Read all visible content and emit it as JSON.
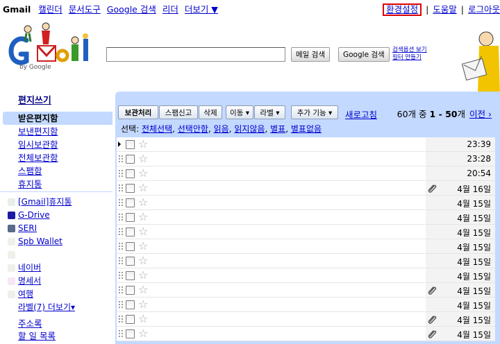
{
  "topnav": {
    "brand": "Gmail",
    "links": [
      "캘린더",
      "문서도구",
      "Google 검색",
      "리더",
      "더보기 ▼"
    ]
  },
  "topright": {
    "settings": "환경설정",
    "help": "도움말",
    "logout": "로그아웃",
    "separator": "|"
  },
  "logo": {
    "byline": "by Google"
  },
  "search": {
    "value": "",
    "mail_search": "메일 검색",
    "web_search": "Google 검색",
    "show_options": "검색옵션 보기",
    "create_filter": "필터 만들기"
  },
  "sidebar": {
    "compose": "편지쓰기",
    "items": [
      {
        "label": "받은편지함",
        "selected": true
      },
      {
        "label": "보낸편지함",
        "selected": false
      },
      {
        "label": "임시보관함",
        "selected": false
      },
      {
        "label": "전체보관함",
        "selected": false
      },
      {
        "label": "스팸함",
        "selected": false
      },
      {
        "label": "휴지통",
        "selected": false
      }
    ],
    "labels": [
      {
        "name": "[Gmail]휴지통",
        "color": "#e8eee8"
      },
      {
        "name": "G-Drive",
        "color": "#1a1aa6"
      },
      {
        "name": "SERI",
        "color": "#5a6a8a"
      },
      {
        "name": "Spb Wallet",
        "color": "#eef1ea"
      },
      {
        "name": "",
        "color": "#eef1ea"
      },
      {
        "name": "네이버",
        "color": "#eef1ea"
      },
      {
        "name": "명세서",
        "color": "#f8e6f4"
      },
      {
        "name": "여행",
        "color": "#eef1ea"
      },
      {
        "name": "라벨(7) 더보기▾",
        "color": ""
      }
    ],
    "extras": [
      "주소록",
      "할 일 목록"
    ]
  },
  "toolbar": {
    "archive": "보관처리",
    "spam": "스팸신고",
    "delete": "삭제",
    "move": "이동 ▾",
    "label": "라벨 ▾",
    "more": "추가 기능 ▾",
    "refresh": "새로고침"
  },
  "pager": {
    "prefix": "60개 중 ",
    "range": "1 - 50",
    "suffix": "개",
    "next": "이전 ›"
  },
  "selectbar": {
    "prefix": "선택: ",
    "options": [
      "전체선택",
      "선택안함",
      "읽음",
      "읽지않음",
      "별표",
      "별표없음"
    ]
  },
  "messages": [
    {
      "date": "23:39",
      "attachment": false
    },
    {
      "date": "23:28",
      "attachment": false
    },
    {
      "date": "20:54",
      "attachment": false
    },
    {
      "date": "4월 16일",
      "attachment": true
    },
    {
      "date": "4월 15일",
      "attachment": false
    },
    {
      "date": "4월 15일",
      "attachment": false
    },
    {
      "date": "4월 15일",
      "attachment": false
    },
    {
      "date": "4월 15일",
      "attachment": false
    },
    {
      "date": "4월 15일",
      "attachment": false
    },
    {
      "date": "4월 15일",
      "attachment": false
    },
    {
      "date": "4월 15일",
      "attachment": true
    },
    {
      "date": "4월 15일",
      "attachment": false
    },
    {
      "date": "4월 15일",
      "attachment": true
    },
    {
      "date": "4월 15일",
      "attachment": true
    }
  ],
  "colors": {
    "panel": "#c3d9ff",
    "link": "#0000cc",
    "highlight_border": "#e00000"
  }
}
